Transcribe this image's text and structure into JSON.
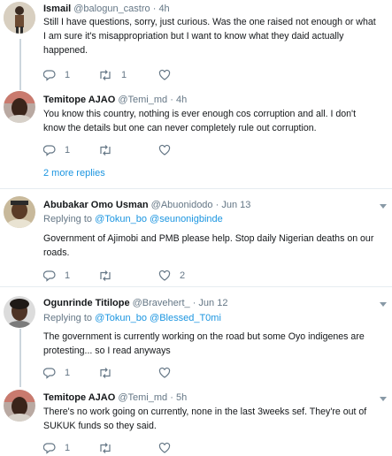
{
  "tweets": [
    {
      "name": "Ismail",
      "handle": "@balogun_castro",
      "time": "4h",
      "lines": [
        "Still I have questions, sorry, just curious. Was the one raised not enough or what",
        "I am sure it's misappropriation but I want to know what they daid actually",
        "happened."
      ],
      "reply_count": "1",
      "retweet_count": "1",
      "like_count": ""
    },
    {
      "name": "Temitope AJAO",
      "handle": "@Temi_md",
      "time": "4h",
      "lines": [
        "You know this country, nothing is ever enough cos corruption and all. I don't",
        "know the details but one can never completely rule out corruption."
      ],
      "reply_count": "1",
      "retweet_count": "",
      "like_count": ""
    },
    {
      "name": "Abubakar Omo Usman",
      "handle": "@Abuonidodo",
      "time": "Jun 13",
      "replying_prefix": "Replying to",
      "replying_to": [
        "@Tokun_bo",
        "@seunonigbinde"
      ],
      "lines": [
        "Government of Ajimobi and PMB please help. Stop daily Nigerian deaths on our",
        "roads."
      ],
      "reply_count": "1",
      "retweet_count": "",
      "like_count": "2"
    },
    {
      "name": "Ogunrinde Titilope",
      "handle": "@Bravehert_",
      "time": "Jun 12",
      "replying_prefix": "Replying to",
      "replying_to": [
        "@Tokun_bo",
        "@Blessed_T0mi"
      ],
      "lines": [
        "The government is currently working on the road but some Oyo indigenes are",
        "protesting... so I read anyways"
      ],
      "reply_count": "1",
      "retweet_count": "",
      "like_count": ""
    },
    {
      "name": "Temitope AJAO",
      "handle": "@Temi_md",
      "time": "5h",
      "lines": [
        "There's no work going on currently, none in the last 3weeks sef. They're out of",
        "SUKUK funds so they said."
      ],
      "reply_count": "1",
      "retweet_count": "",
      "like_count": ""
    }
  ],
  "more_replies": "2 more replies",
  "time_separator": "·",
  "colors": {
    "accent": "#1b95e0",
    "secondary_text": "#657786",
    "divider": "#e6ecf0",
    "thread_line": "#ccd6dd"
  }
}
